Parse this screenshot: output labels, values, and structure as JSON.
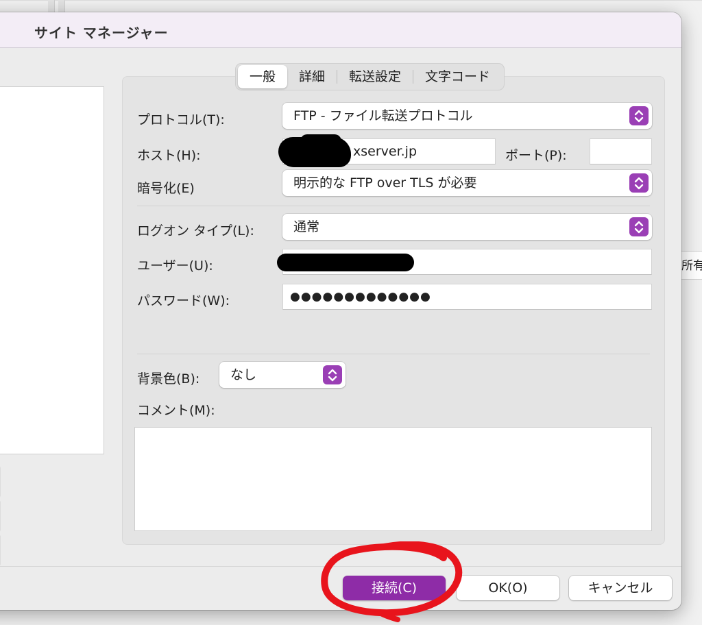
{
  "window": {
    "title": "サイト マネージャー"
  },
  "tabs": [
    {
      "label": "一般",
      "active": true
    },
    {
      "label": "詳細",
      "active": false
    },
    {
      "label": "転送設定",
      "active": false
    },
    {
      "label": "文字コード",
      "active": false
    }
  ],
  "form": {
    "protocol": {
      "label": "プロトコル(T):",
      "value": "FTP - ファイル転送プロトコル"
    },
    "host": {
      "label": "ホスト(H):",
      "value": "xserver.jp"
    },
    "port": {
      "label": "ポート(P):",
      "value": ""
    },
    "encryption": {
      "label": "暗号化(E)",
      "value": "明示的な FTP over TLS が必要"
    },
    "logon_type": {
      "label": "ログオン タイプ(L):",
      "value": "通常"
    },
    "user": {
      "label": "ユーザー(U):",
      "value": ""
    },
    "password": {
      "label": "パスワード(W):",
      "value": "●●●●●●●●●●●●●"
    },
    "background_color": {
      "label": "背景色(B):",
      "value": "なし"
    },
    "comment": {
      "label": "コメント(M):",
      "value": ""
    }
  },
  "buttons": {
    "connect": "接続(C)",
    "ok": "OK(O)",
    "cancel": "キャンセル"
  },
  "background": {
    "partial_text": "所有"
  },
  "colors": {
    "accent": "#9a3fb5",
    "primary_button": "#8e2ca7",
    "annotation": "#e8141c"
  },
  "icons": {
    "select_chevron": "chevron-up-down-icon"
  }
}
